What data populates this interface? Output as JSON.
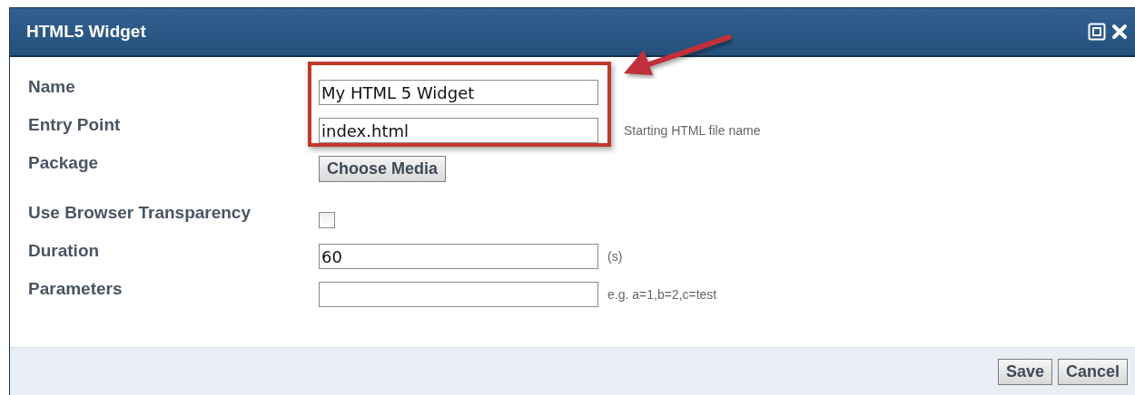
{
  "window": {
    "title": "HTML5 Widget"
  },
  "fields": [
    {
      "label": "Name",
      "kind": "text",
      "value": "My HTML 5 Widget"
    },
    {
      "label": "Entry Point",
      "kind": "text",
      "value": "index.html",
      "hint": "Starting HTML file name"
    },
    {
      "label": "Package",
      "kind": "button",
      "button": "Choose Media"
    },
    {
      "label": "Use Browser Transparency",
      "kind": "checkbox",
      "checked": false
    },
    {
      "label": "Duration",
      "kind": "text",
      "value": "60",
      "hint": "(s)"
    },
    {
      "label": "Parameters",
      "kind": "text",
      "hint": "e.g. a=1,b=2,c=test"
    }
  ],
  "buttons": [
    "Save",
    "Cancel"
  ]
}
